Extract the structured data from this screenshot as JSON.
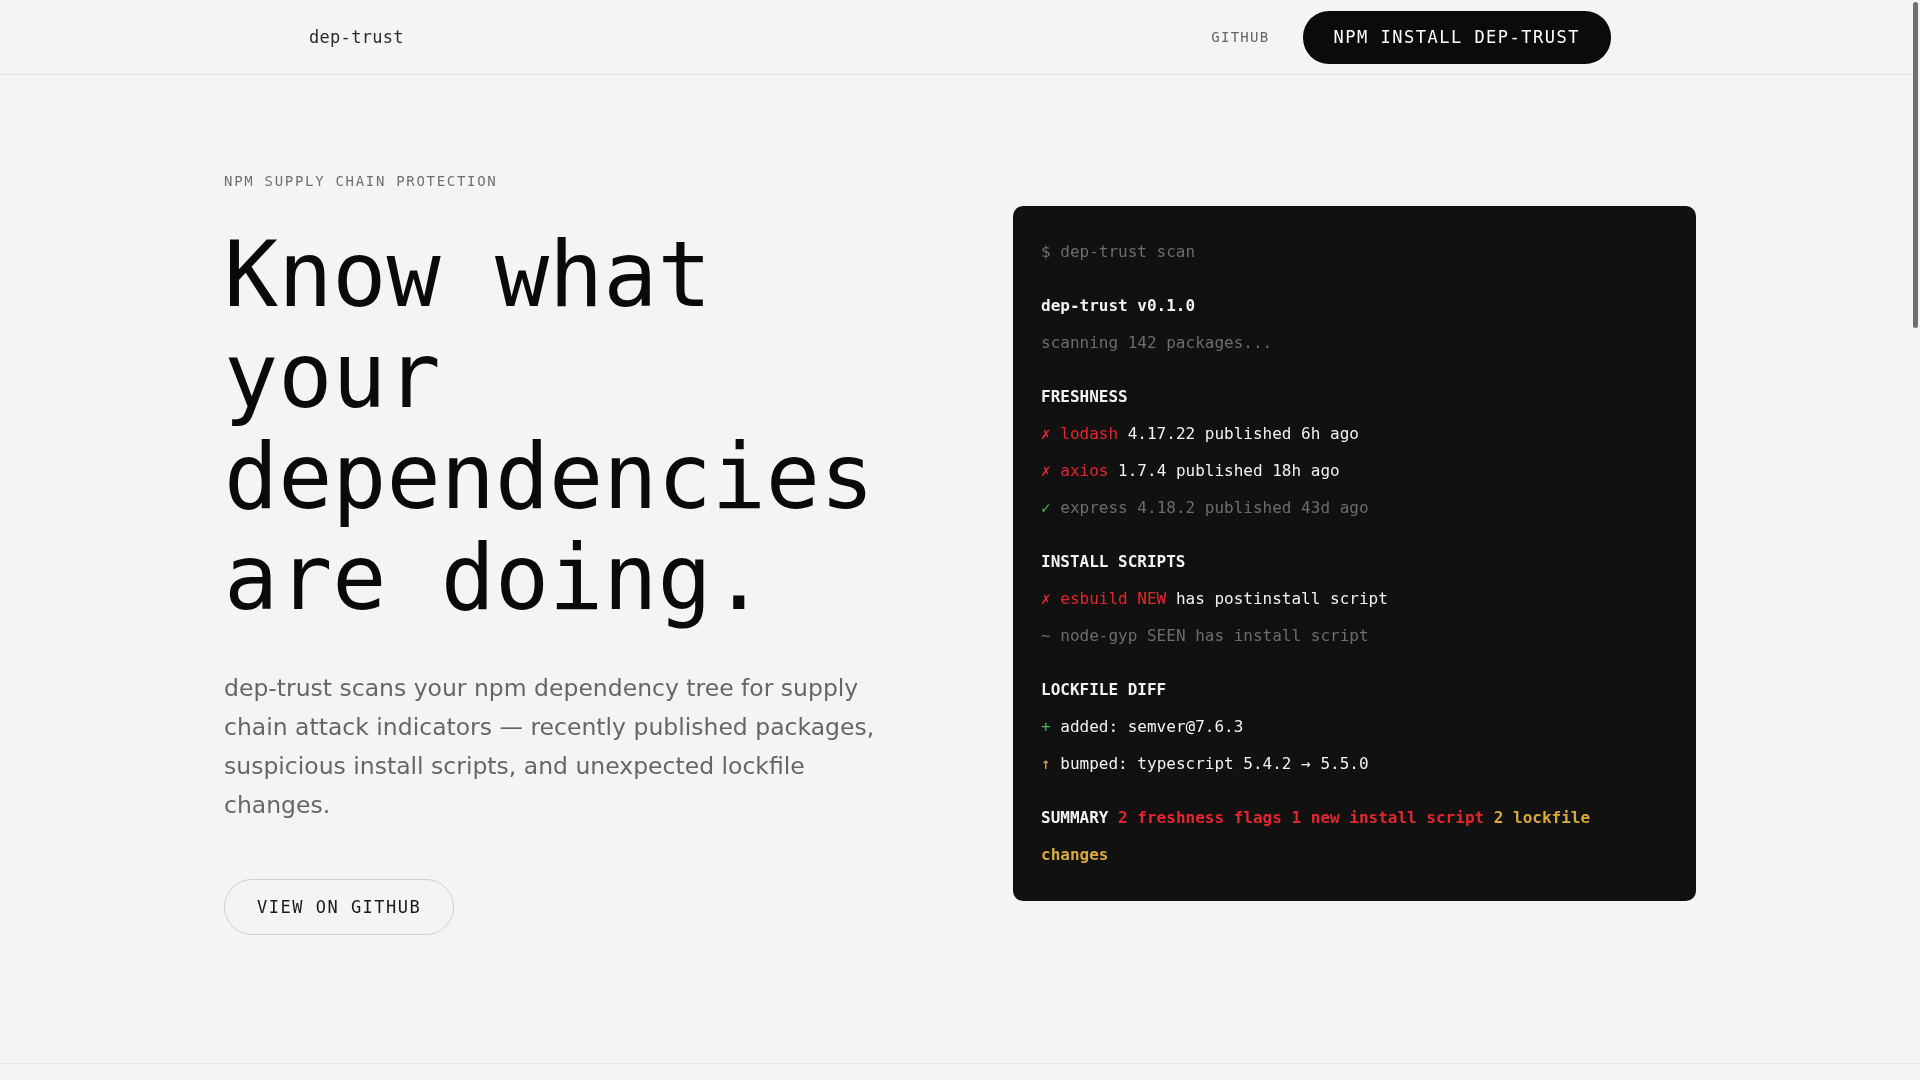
{
  "header": {
    "logo": "dep-trust",
    "nav_link": "GITHUB",
    "install_button": "NPM INSTALL DEP-TRUST"
  },
  "hero": {
    "eyebrow": "NPM SUPPLY CHAIN PROTECTION",
    "headline": "Know what your dependencies are doing.",
    "description": "dep-trust scans your npm dependency tree for supply chain attack indicators — recently published packages, suspicious install scripts, and unexpected lockfile changes.",
    "github_button": "VIEW ON GITHUB"
  },
  "terminal": {
    "command": "$ dep-trust scan",
    "title": "dep-trust v0.1.0",
    "scan_message": "scanning 142 packages...",
    "sections": [
      {
        "heading": "FRESHNESS",
        "lines": [
          {
            "kind": "flag",
            "marker": "✗",
            "name": "lodash",
            "detail": "4.17.22 published 6h ago"
          },
          {
            "kind": "flag",
            "marker": "✗",
            "name": "axios",
            "detail": "1.7.4 published 18h ago"
          },
          {
            "kind": "ok",
            "marker": "✓",
            "name": "express",
            "detail": "4.18.2 published 43d ago"
          }
        ]
      },
      {
        "heading": "INSTALL SCRIPTS",
        "lines": [
          {
            "kind": "flag",
            "marker": "✗",
            "name": "esbuild NEW",
            "detail": "has postinstall script"
          },
          {
            "kind": "seen",
            "marker": "~",
            "name": "node-gyp SEEN",
            "detail": "has install script"
          }
        ]
      },
      {
        "heading": "LOCKFILE DIFF",
        "lines": [
          {
            "kind": "added",
            "marker": "+",
            "name": "added:",
            "detail": "semver@7.6.3"
          },
          {
            "kind": "bumped",
            "marker": "↑",
            "name": "bumped:",
            "detail": "typescript 5.4.2 → 5.5.0"
          }
        ]
      }
    ],
    "summary": {
      "label": "SUMMARY",
      "items": [
        {
          "kind": "danger",
          "text": "2 freshness flags"
        },
        {
          "kind": "danger",
          "text": "1 new install script"
        },
        {
          "kind": "warning",
          "text": "2 lockfile changes"
        }
      ]
    }
  }
}
